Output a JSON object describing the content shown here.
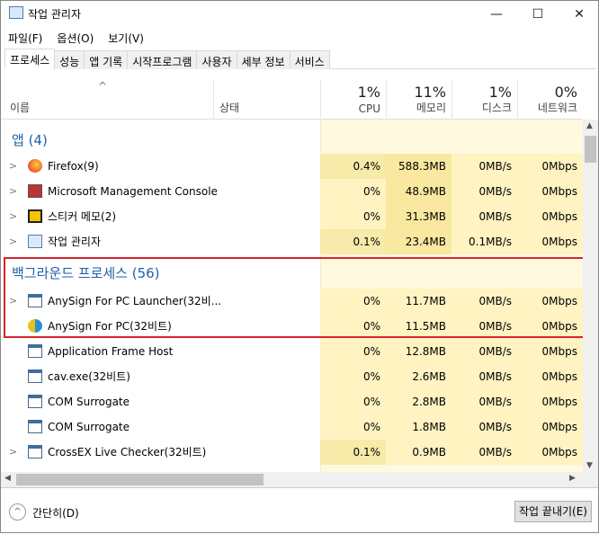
{
  "window": {
    "title": "작업 관리자",
    "minimize": "—",
    "maximize": "☐",
    "close": "✕"
  },
  "menu": [
    "파일(F)",
    "옵션(O)",
    "보기(V)"
  ],
  "tabs": [
    "프로세스",
    "성능",
    "앱 기록",
    "시작프로그램",
    "사용자",
    "세부 정보",
    "서비스"
  ],
  "header": {
    "sort_arrow": "^",
    "name": "이름",
    "status": "상태",
    "columns": [
      {
        "pct": "1%",
        "label": "CPU"
      },
      {
        "pct": "11%",
        "label": "메모리"
      },
      {
        "pct": "1%",
        "label": "디스크"
      },
      {
        "pct": "0%",
        "label": "네트워크"
      }
    ]
  },
  "groups": {
    "apps": "앱 (4)",
    "background": "백그라운드 프로세스 (56)"
  },
  "apps": [
    {
      "name": "Firefox(9)",
      "expand": ">",
      "cpu": "0.4%",
      "mem": "588.3MB",
      "disk": "0MB/s",
      "net": "0Mbps"
    },
    {
      "name": "Microsoft Management Console",
      "expand": ">",
      "cpu": "0%",
      "mem": "48.9MB",
      "disk": "0MB/s",
      "net": "0Mbps"
    },
    {
      "name": "스티커 메모(2)",
      "expand": ">",
      "cpu": "0%",
      "mem": "31.3MB",
      "disk": "0MB/s",
      "net": "0Mbps"
    },
    {
      "name": "작업 관리자",
      "expand": ">",
      "cpu": "0.1%",
      "mem": "23.4MB",
      "disk": "0.1MB/s",
      "net": "0Mbps"
    }
  ],
  "background": [
    {
      "name": "AnySign For PC Launcher(32비...",
      "expand": ">",
      "cpu": "0%",
      "mem": "11.7MB",
      "disk": "0MB/s",
      "net": "0Mbps"
    },
    {
      "name": "AnySign For PC(32비트)",
      "expand": "",
      "cpu": "0%",
      "mem": "11.5MB",
      "disk": "0MB/s",
      "net": "0Mbps"
    },
    {
      "name": "Application Frame Host",
      "expand": "",
      "cpu": "0%",
      "mem": "12.8MB",
      "disk": "0MB/s",
      "net": "0Mbps"
    },
    {
      "name": "cav.exe(32비트)",
      "expand": "",
      "cpu": "0%",
      "mem": "2.6MB",
      "disk": "0MB/s",
      "net": "0Mbps"
    },
    {
      "name": "COM Surrogate",
      "expand": "",
      "cpu": "0%",
      "mem": "2.8MB",
      "disk": "0MB/s",
      "net": "0Mbps"
    },
    {
      "name": "COM Surrogate",
      "expand": "",
      "cpu": "0%",
      "mem": "1.8MB",
      "disk": "0MB/s",
      "net": "0Mbps"
    },
    {
      "name": "CrossEX Live Checker(32비트)",
      "expand": ">",
      "cpu": "0.1%",
      "mem": "0.9MB",
      "disk": "0MB/s",
      "net": "0Mbps"
    }
  ],
  "footer": {
    "fewer_details": "간단히(D)",
    "end_task": "작업 끝내기(E)"
  },
  "colors": {
    "heat_light": "#fff9e0",
    "heat": "#fff3c2",
    "heat_dark": "#f8e8a0",
    "group": "#1e5fa8",
    "highlight_box": "#d9232e"
  }
}
